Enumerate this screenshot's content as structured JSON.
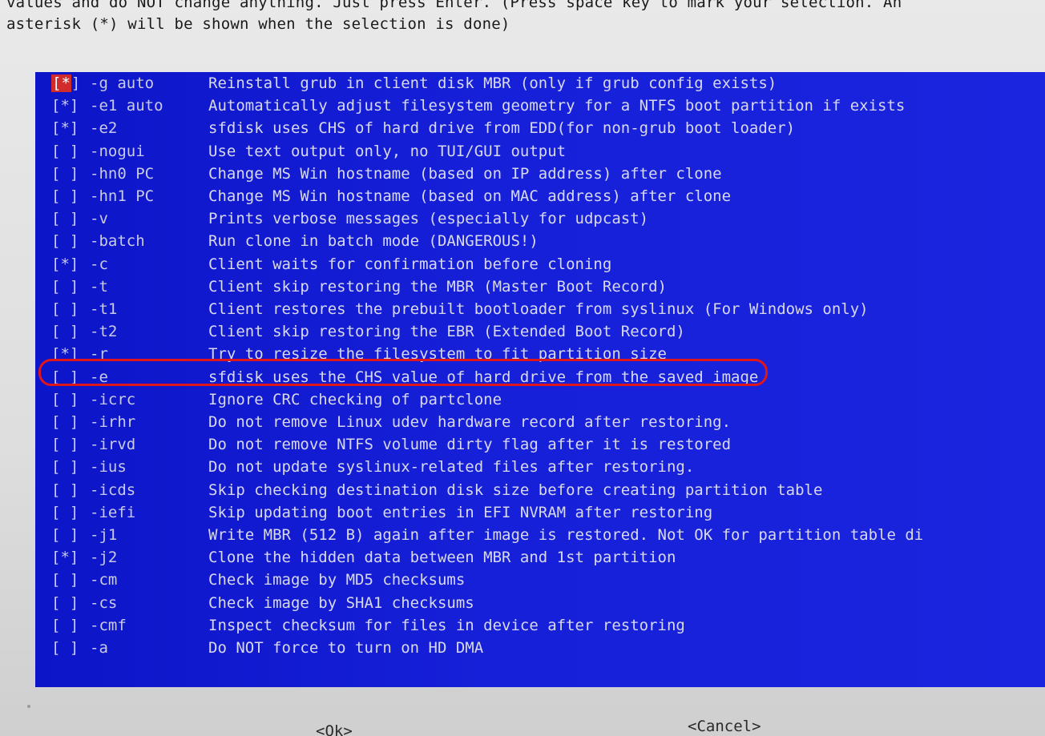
{
  "intro": {
    "line1": "values and do NOT change anything. Just press Enter. (Press space key to mark your selection. An",
    "line2": "asterisk (*) will be shown when the selection is done)"
  },
  "options": [
    {
      "check": "[*]",
      "flag": "-g auto",
      "desc": "Reinstall grub in client disk MBR (only if grub config exists)",
      "selected": true,
      "cursor": true
    },
    {
      "check": "[*]",
      "flag": "-e1 auto",
      "desc": "Automatically adjust filesystem geometry for a NTFS boot partition if exists",
      "selected": true
    },
    {
      "check": "[*]",
      "flag": "-e2",
      "desc": "sfdisk uses CHS of hard drive from EDD(for non-grub boot loader)",
      "selected": true
    },
    {
      "check": "[ ]",
      "flag": "-nogui",
      "desc": "Use text output only, no TUI/GUI output",
      "selected": false
    },
    {
      "check": "[ ]",
      "flag": "-hn0 PC",
      "desc": "Change MS Win hostname (based on IP address) after clone",
      "selected": false
    },
    {
      "check": "[ ]",
      "flag": "-hn1 PC",
      "desc": "Change MS Win hostname (based on MAC address) after clone",
      "selected": false
    },
    {
      "check": "[ ]",
      "flag": "-v",
      "desc": "Prints verbose messages (especially for udpcast)",
      "selected": false
    },
    {
      "check": "[ ]",
      "flag": "-batch",
      "desc": "Run clone in batch mode (DANGEROUS!)",
      "selected": false
    },
    {
      "check": "[*]",
      "flag": "-c",
      "desc": "Client waits for confirmation before cloning",
      "selected": true
    },
    {
      "check": "[ ]",
      "flag": "-t",
      "desc": "Client skip restoring the MBR (Master Boot Record)",
      "selected": false
    },
    {
      "check": "[ ]",
      "flag": "-t1",
      "desc": "Client restores the prebuilt bootloader from syslinux (For Windows only)",
      "selected": false
    },
    {
      "check": "[ ]",
      "flag": "-t2",
      "desc": "Client skip restoring the EBR (Extended Boot Record)",
      "selected": false
    },
    {
      "check": "[*]",
      "flag": "-r",
      "desc": "Try to resize the filesystem to fit partition size",
      "selected": true,
      "circled": true
    },
    {
      "check": "[ ]",
      "flag": "-e",
      "desc": "sfdisk uses the CHS value of hard drive from the saved image",
      "selected": false
    },
    {
      "check": "[ ]",
      "flag": "-icrc",
      "desc": "Ignore CRC checking of partclone",
      "selected": false
    },
    {
      "check": "[ ]",
      "flag": "-irhr",
      "desc": "Do not remove Linux udev hardware record after restoring.",
      "selected": false
    },
    {
      "check": "[ ]",
      "flag": "-irvd",
      "desc": "Do not remove NTFS volume dirty flag after it is restored",
      "selected": false
    },
    {
      "check": "[ ]",
      "flag": "-ius",
      "desc": "Do not update syslinux-related files after restoring.",
      "selected": false
    },
    {
      "check": "[ ]",
      "flag": "-icds",
      "desc": "Skip checking destination disk size before creating partition table",
      "selected": false
    },
    {
      "check": "[ ]",
      "flag": "-iefi",
      "desc": "Skip updating boot entries in EFI NVRAM after restoring",
      "selected": false
    },
    {
      "check": "[ ]",
      "flag": "-j1",
      "desc": "Write MBR (512 B) again after image is restored. Not OK for partition table di",
      "selected": false
    },
    {
      "check": "[*]",
      "flag": "-j2",
      "desc": "Clone the hidden data between MBR and 1st partition",
      "selected": true
    },
    {
      "check": "[ ]",
      "flag": "-cm",
      "desc": "Check image by MD5 checksums",
      "selected": false
    },
    {
      "check": "[ ]",
      "flag": "-cs",
      "desc": "Check image by SHA1 checksums",
      "selected": false
    },
    {
      "check": "[ ]",
      "flag": "-cmf",
      "desc": "Inspect checksum for files in device after restoring",
      "selected": false
    },
    {
      "check": "[ ]",
      "flag": "-a",
      "desc": "Do NOT force to turn on HD DMA",
      "selected": false
    }
  ],
  "buttons": {
    "ok": "<Ok>",
    "cancel": "<Cancel>"
  },
  "colors": {
    "panel": "#1018d6",
    "text": "#c9cbe6",
    "circle": "#e0161b",
    "cursor": "#d22b2b"
  }
}
